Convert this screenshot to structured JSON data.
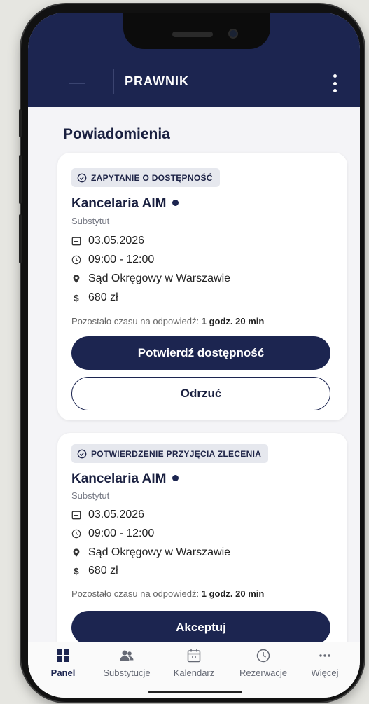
{
  "app": {
    "title": "PRAWNIK"
  },
  "section": {
    "title": "Powiadomienia"
  },
  "cards": [
    {
      "badge": "ZAPYTANIE O DOSTĘPNOŚĆ",
      "client": "Kancelaria AIM",
      "role": "Substytut",
      "date": "03.05.2026",
      "time": "09:00 - 12:00",
      "location": "Sąd Okręgowy w Warszawie",
      "price": "680 zł",
      "remaining_label": "Pozostało czasu na odpowiedź:",
      "remaining_value": "1 godz. 20 min",
      "primary_button": "Potwierdź dostępność",
      "secondary_button": "Odrzuć"
    },
    {
      "badge": "POTWIERDZENIE PRZYJĘCIA ZLECENIA",
      "client": "Kancelaria AIM",
      "role": "Substytut",
      "date": "03.05.2026",
      "time": "09:00 - 12:00",
      "location": "Sąd Okręgowy w Warszawie",
      "price": "680 zł",
      "remaining_label": "Pozostało czasu na odpowiedź:",
      "remaining_value": "1 godz. 20 min",
      "primary_button": "Akceptuj"
    }
  ],
  "tabs": [
    {
      "label": "Panel",
      "icon": "dashboard-icon",
      "active": true
    },
    {
      "label": "Substytucje",
      "icon": "users-icon"
    },
    {
      "label": "Kalendarz",
      "icon": "calendar-icon"
    },
    {
      "label": "Rezerwacje",
      "icon": "clock-icon"
    },
    {
      "label": "Więcej",
      "icon": "more-icon"
    }
  ],
  "colors": {
    "primary": "#1c2550",
    "background": "#f4f4f7"
  }
}
